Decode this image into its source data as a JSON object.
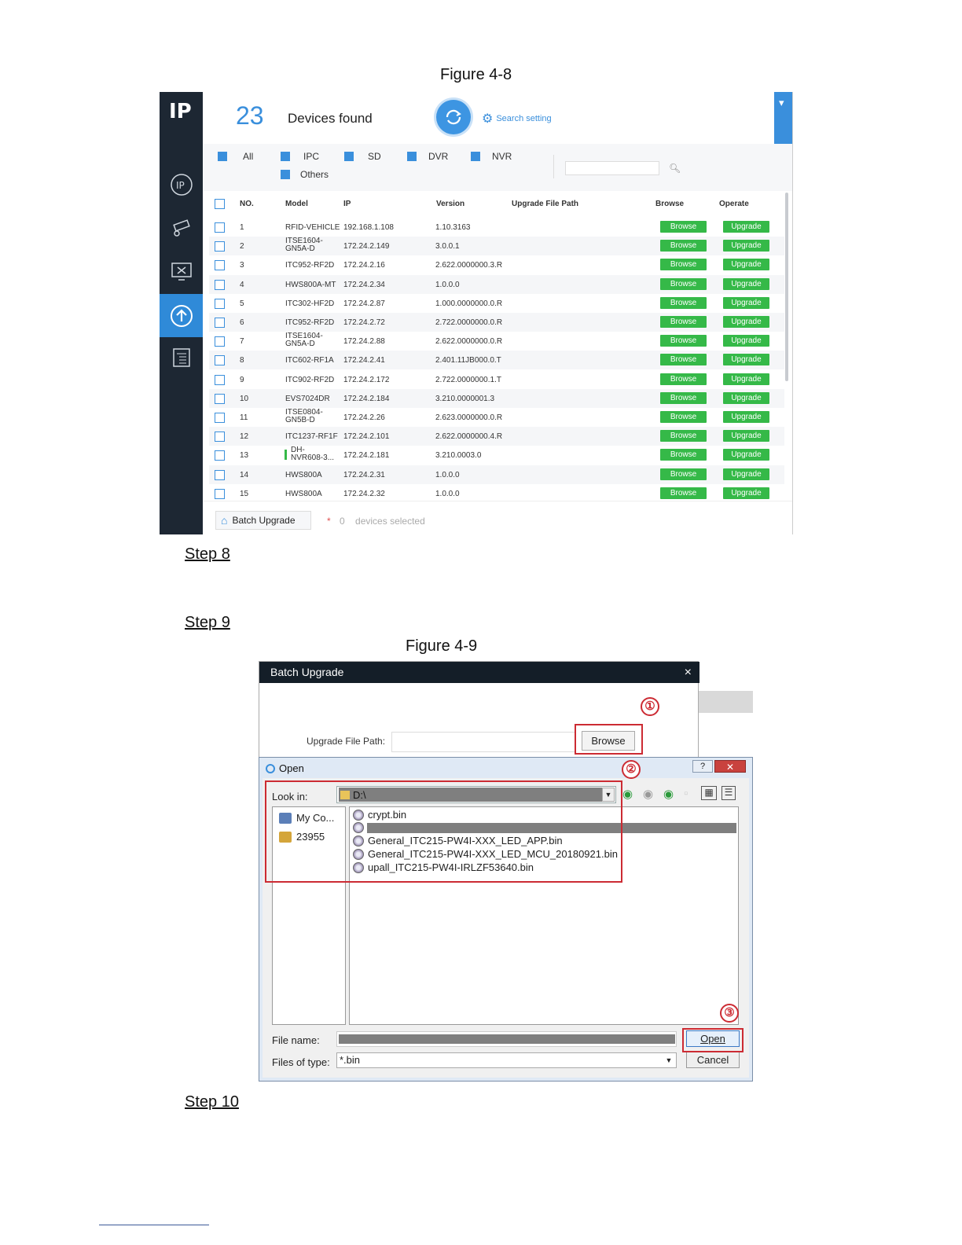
{
  "figure1": {
    "caption": "Figure 4-8"
  },
  "app": {
    "logo": "IP",
    "device_count": "23",
    "devices_found_label": "Devices found",
    "search_setting_label": "Search setting",
    "window_controls": [
      "▾",
      "–",
      "✕"
    ],
    "filters": [
      "All",
      "IPC",
      "SD",
      "DVR",
      "NVR",
      "Others"
    ],
    "search_placeholder": "",
    "columns": [
      "NO.",
      "Model",
      "IP",
      "Version",
      "Upgrade File Path",
      "Browse",
      "Operate"
    ],
    "browse_label": "Browse",
    "upgrade_label": "Upgrade",
    "rows": [
      {
        "no": "1",
        "model": "RFID-VEHICLE",
        "ip": "192.168.1.108",
        "version": "1.10.3163"
      },
      {
        "no": "2",
        "model": "ITSE1604-\nGN5A-D",
        "ip": "172.24.2.149",
        "version": "3.0.0.1"
      },
      {
        "no": "3",
        "model": "ITC952-RF2D",
        "ip": "172.24.2.16",
        "version": "2.622.0000000.3.R"
      },
      {
        "no": "4",
        "model": "HWS800A-MT",
        "ip": "172.24.2.34",
        "version": "1.0.0.0"
      },
      {
        "no": "5",
        "model": "ITC302-HF2D",
        "ip": "172.24.2.87",
        "version": "1.000.0000000.0.R"
      },
      {
        "no": "6",
        "model": "ITC952-RF2D",
        "ip": "172.24.2.72",
        "version": "2.722.0000000.0.R"
      },
      {
        "no": "7",
        "model": "ITSE1604-\nGN5A-D",
        "ip": "172.24.2.88",
        "version": "2.622.0000000.0.R"
      },
      {
        "no": "8",
        "model": "ITC602-RF1A",
        "ip": "172.24.2.41",
        "version": "2.401.11JB000.0.T"
      },
      {
        "no": "9",
        "model": "ITC902-RF2D",
        "ip": "172.24.2.172",
        "version": "2.722.0000000.1.T"
      },
      {
        "no": "10",
        "model": "EVS7024DR",
        "ip": "172.24.2.184",
        "version": "3.210.0000001.3"
      },
      {
        "no": "11",
        "model": "ITSE0804-\nGN5B-D",
        "ip": "172.24.2.26",
        "version": "2.623.0000000.0.R"
      },
      {
        "no": "12",
        "model": "ITC1237-RF1F",
        "ip": "172.24.2.101",
        "version": "2.622.0000000.4.R"
      },
      {
        "no": "13",
        "model": "DH-\nNVR608-3...",
        "ip": "172.24.2.181",
        "version": "3.210.0003.0"
      },
      {
        "no": "14",
        "model": "HWS800A",
        "ip": "172.24.2.31",
        "version": "1.0.0.0"
      },
      {
        "no": "15",
        "model": "HWS800A",
        "ip": "172.24.2.32",
        "version": "1.0.0.0"
      }
    ],
    "batch_upgrade_label": "Batch Upgrade",
    "selected_star": "*",
    "selected_count": "0",
    "selected_label": "devices selected"
  },
  "steps": {
    "step8": "Step 8",
    "step9": "Step 9",
    "step10": "Step 10"
  },
  "figure2": {
    "caption": "Figure 4-9",
    "batch_dialog": {
      "title": "Batch Upgrade",
      "close": "×",
      "path_label": "Upgrade File Path:",
      "browse_label": "Browse"
    },
    "badges": [
      "①",
      "②",
      "③"
    ],
    "open_dialog": {
      "title": "Open",
      "help": "?",
      "close": "✕",
      "look_in_label": "Look in:",
      "look_in_value": "D:\\",
      "places": [
        "My Co...",
        "23955"
      ],
      "files": [
        "crypt.bin",
        "",
        "General_ITC215-PW4I-XXX_LED_APP.bin",
        "General_ITC215-PW4I-XXX_LED_MCU_20180921.bin",
        "upall_ITC215-PW4I-IRLZF53640.bin"
      ],
      "file_name_label": "File name:",
      "files_of_type_label": "Files of type:",
      "files_of_type_value": "*.bin",
      "open_label": "Open",
      "cancel_label": "Cancel"
    }
  }
}
